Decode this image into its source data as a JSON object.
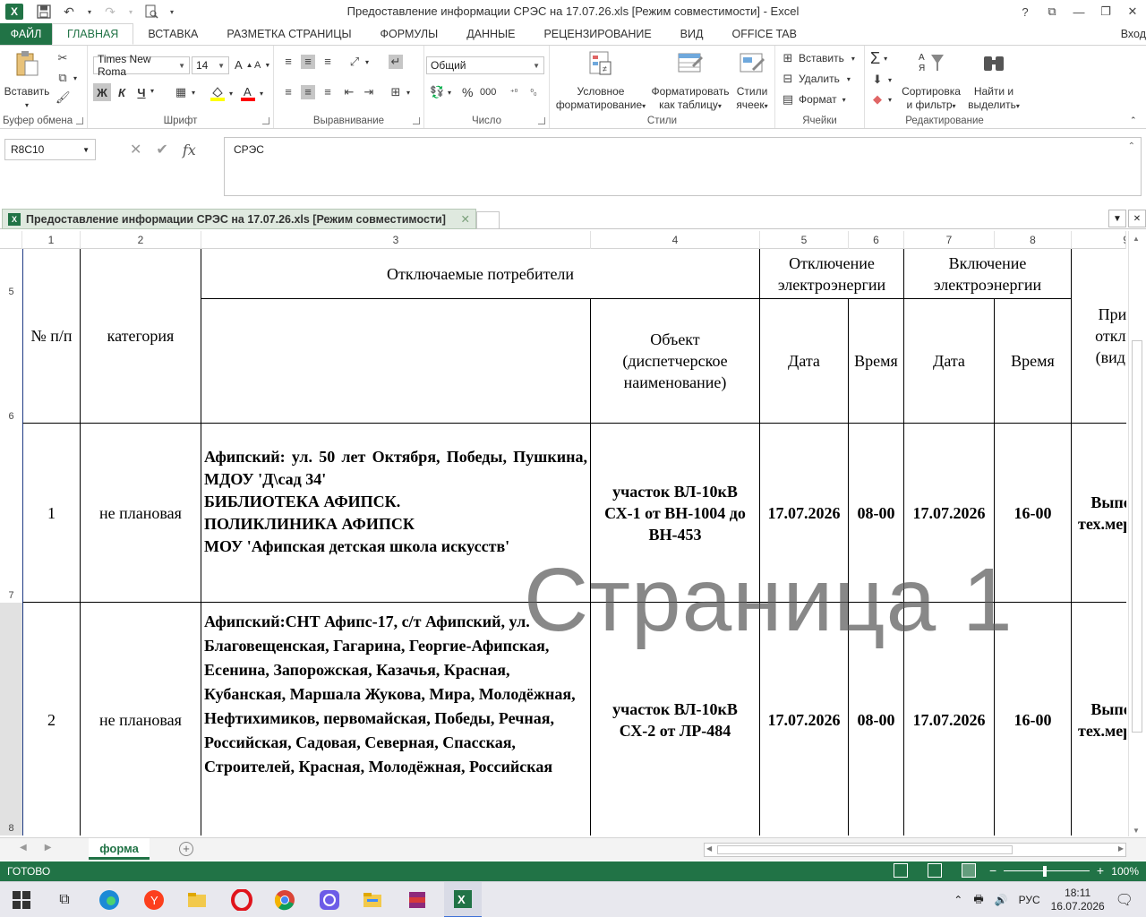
{
  "window": {
    "title": "Предоставление информации СРЭС на 17.07.26.xls  [Режим совместимости] - Excel",
    "help": "?",
    "controls": [
      "?",
      "⧉",
      "—",
      "❐",
      "✕"
    ]
  },
  "ribbon_tabs": {
    "file": "ФАЙЛ",
    "tabs": [
      "ГЛАВНАЯ",
      "ВСТАВКА",
      "РАЗМЕТКА СТРАНИЦЫ",
      "ФОРМУЛЫ",
      "ДАННЫЕ",
      "РЕЦЕНЗИРОВАНИЕ",
      "ВИД",
      "OFFICE TAB"
    ],
    "active": "ГЛАВНАЯ",
    "login": "Вход"
  },
  "ribbon": {
    "clipboard": {
      "paste": "Вставить",
      "label": "Буфер обмена"
    },
    "font": {
      "name": "Times New Roma",
      "size": "14",
      "bold": "Ж",
      "italic": "К",
      "underline": "Ч",
      "grow": "A",
      "shrink": "A",
      "label": "Шрифт"
    },
    "alignment": {
      "label": "Выравнивание"
    },
    "number": {
      "format": "Общий",
      "percent": "%",
      "thousands": "000",
      "label": "Число"
    },
    "styles": {
      "conditional_1": "Условное",
      "conditional_2": "форматирование",
      "table_1": "Форматировать",
      "table_2": "как таблицу",
      "cell_1": "Стили",
      "cell_2": "ячеек",
      "label": "Стили"
    },
    "cells": {
      "insert": "Вставить",
      "delete": "Удалить",
      "format": "Формат",
      "label": "Ячейки"
    },
    "editing": {
      "sort_1": "Сортировка",
      "sort_2": "и фильтр",
      "find_1": "Найти и",
      "find_2": "выделить",
      "label": "Редактирование"
    }
  },
  "formula_bar": {
    "name_box": "R8C10",
    "fx": "fx",
    "content": "СРЭС"
  },
  "doc_tab": {
    "title": "Предоставление информации СРЭС на 17.07.26.xls  [Режим совместимости]"
  },
  "sheet": {
    "col_headers": [
      "1",
      "2",
      "3",
      "4",
      "5",
      "6",
      "7",
      "8",
      "9"
    ],
    "row_headers": [
      "5",
      "6",
      "7",
      "8"
    ],
    "header": {
      "num": "№ п/п",
      "category": "категория",
      "consumers": "Отключаемые потребители",
      "object": "Объект (диспетчерское наименование)",
      "off": "Отключение электроэнергии",
      "on": "Включение электроэнергии",
      "date1": "Дата",
      "time1": "Время",
      "date2": "Дата",
      "time2": "Время",
      "reason": "Прич отклю (вид р"
    },
    "rows": [
      {
        "num": "1",
        "category": "не плановая",
        "consumers_line1": "Афипский: ул. 50 лет Октября, Победы, Пушкина, МДОУ 'Д\\сад 34'",
        "consumers_rest": "БИБЛИОТЕКА АФИПСК.\nПОЛИКЛИНИКА АФИПСК\nМОУ 'Афипская детская школа искусств'",
        "object": "участок ВЛ-10кВ СХ-1 от ВН-1004 до ВН-453",
        "off_date": "17.07.2026",
        "off_time": "08-00",
        "on_date": "17.07.2026",
        "on_time": "16-00",
        "reason": "Выпол тех.мер ти"
      },
      {
        "num": "2",
        "category": "не плановая",
        "consumers": "Афипский:СНТ Афипс-17, с/т Афипский, ул. Благовещенская, Гагарина, Георгие-Афипская, Есенина, Запорожская, Казачья, Красная, Кубанская, Маршала Жукова, Мира, Молодёжная, Нефтихимиков, первомайская, Победы, Речная, Российская, Садовая, Северная, Спасская, Строителей, Красная, Молодёжная, Российская",
        "object": "участок ВЛ-10кВ СХ-2 от ЛР-484",
        "off_date": "17.07.2026",
        "off_time": "08-00",
        "on_date": "17.07.2026",
        "on_time": "16-00",
        "reason": "Выпол тех.мер ти"
      }
    ],
    "watermark": "Страница 1"
  },
  "sheet_tabs": {
    "active": "форма",
    "add": "+"
  },
  "status": {
    "ready": "ГОТОВО",
    "zoom": "100%"
  },
  "taskbar": {
    "lang": "РУС",
    "time": "18:11",
    "date": "16.07.2026"
  },
  "colors": {
    "excel_green": "#217346"
  }
}
